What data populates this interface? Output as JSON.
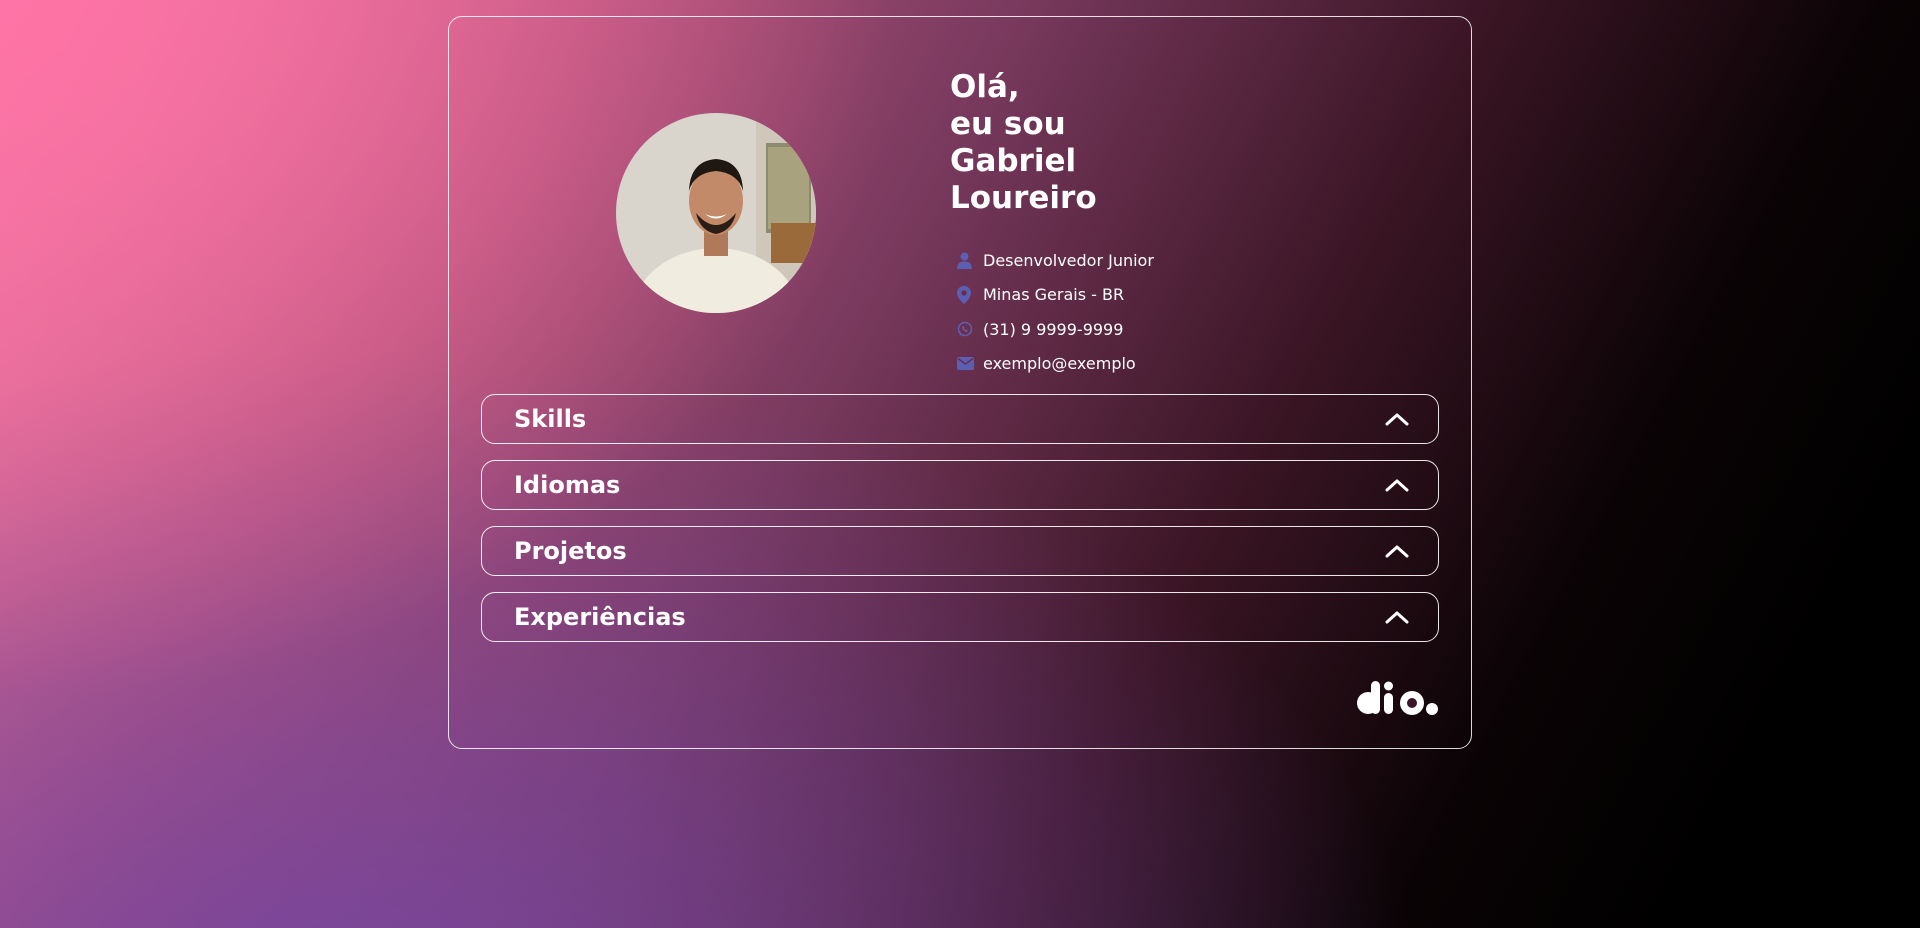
{
  "profile": {
    "greeting_lines": [
      "Olá,",
      "eu sou",
      "Gabriel",
      "Loureiro"
    ],
    "info": [
      {
        "icon": "user-icon",
        "text": "Desenvolvedor Junior"
      },
      {
        "icon": "location-pin-icon",
        "text": "Minas Gerais - BR"
      },
      {
        "icon": "whatsapp-icon",
        "text": "(31) 9 9999-9999"
      },
      {
        "icon": "envelope-icon",
        "text": "exemplo@exemplo"
      }
    ],
    "icon_color": "#5b5fb4"
  },
  "sections": [
    {
      "title": "Skills"
    },
    {
      "title": "Idiomas"
    },
    {
      "title": "Projetos"
    },
    {
      "title": "Experiências"
    }
  ],
  "logo": {
    "text": "dio."
  }
}
